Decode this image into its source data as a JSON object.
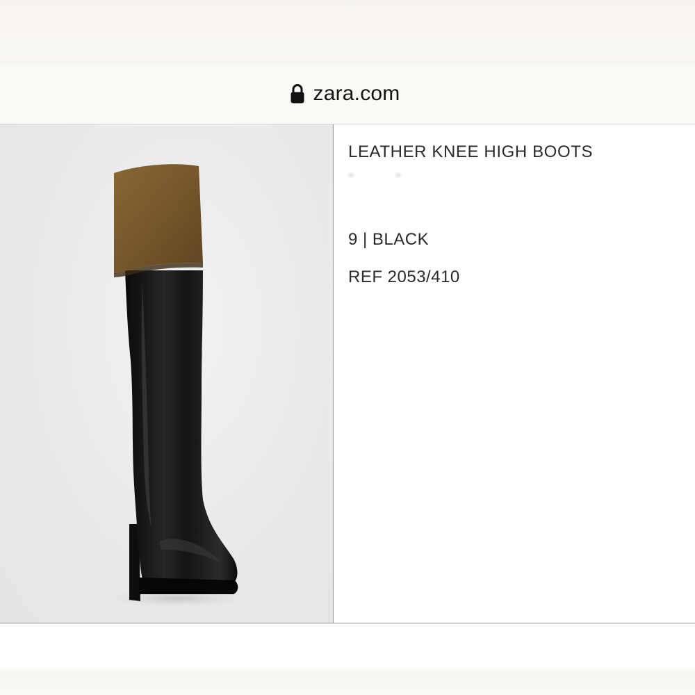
{
  "browser": {
    "url": "zara.com",
    "lock_icon": "lock-icon"
  },
  "product": {
    "title": "LEATHER KNEE HIGH BOOTS",
    "size_color": "9 | BLACK",
    "reference": "REF 2053/410",
    "image_alt": "Black leather knee high boot with brown suede fold-over cuff"
  },
  "colors": {
    "boot_leather": "#121212",
    "cuff_suede": "#7a5a2e",
    "background": "#e9eaea"
  }
}
